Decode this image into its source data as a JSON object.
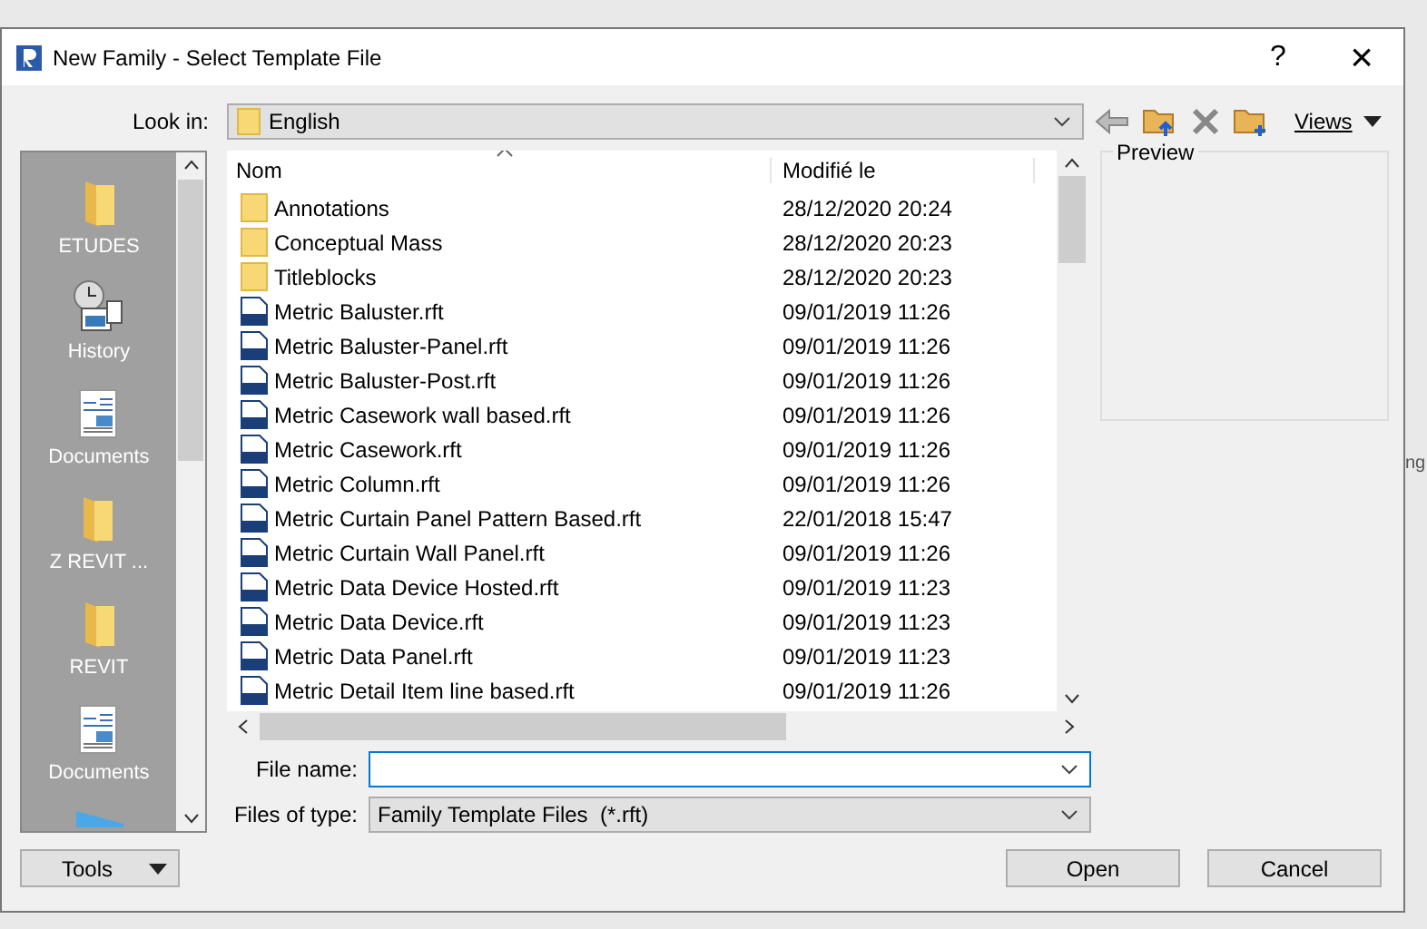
{
  "window": {
    "title": "New Family - Select Template File",
    "buttons": [
      "?",
      "×"
    ]
  },
  "look_in": {
    "label": "Look in:",
    "value": "English"
  },
  "toolbar": {
    "views_label": "Views"
  },
  "places": [
    {
      "kind": "folder",
      "label": "ETUDES"
    },
    {
      "kind": "history",
      "label": "History"
    },
    {
      "kind": "documents",
      "label": "Documents"
    },
    {
      "kind": "folder",
      "label": "Z REVIT ..."
    },
    {
      "kind": "folder",
      "label": "REVIT"
    },
    {
      "kind": "documents",
      "label": "Documents"
    },
    {
      "kind": "desktop"
    }
  ],
  "file_list": {
    "columns": [
      "Nom",
      "Modifié le"
    ],
    "rows": [
      {
        "kind": "folder",
        "name": "Annotations",
        "modified": "28/12/2020 20:24"
      },
      {
        "kind": "folder",
        "name": "Conceptual Mass",
        "modified": "28/12/2020 20:23"
      },
      {
        "kind": "folder",
        "name": "Titleblocks",
        "modified": "28/12/2020 20:23"
      },
      {
        "kind": "rft",
        "name": "Metric Baluster.rft",
        "modified": "09/01/2019 11:26"
      },
      {
        "kind": "rft",
        "name": "Metric Baluster-Panel.rft",
        "modified": "09/01/2019 11:26"
      },
      {
        "kind": "rft",
        "name": "Metric Baluster-Post.rft",
        "modified": "09/01/2019 11:26"
      },
      {
        "kind": "rft",
        "name": "Metric Casework wall based.rft",
        "modified": "09/01/2019 11:26"
      },
      {
        "kind": "rft",
        "name": "Metric Casework.rft",
        "modified": "09/01/2019 11:26"
      },
      {
        "kind": "rft",
        "name": "Metric Column.rft",
        "modified": "09/01/2019 11:26"
      },
      {
        "kind": "rft",
        "name": "Metric Curtain Panel Pattern Based.rft",
        "modified": "22/01/2018 15:47"
      },
      {
        "kind": "rft",
        "name": "Metric Curtain Wall Panel.rft",
        "modified": "09/01/2019 11:26"
      },
      {
        "kind": "rft",
        "name": "Metric Data Device Hosted.rft",
        "modified": "09/01/2019 11:23"
      },
      {
        "kind": "rft",
        "name": "Metric Data Device.rft",
        "modified": "09/01/2019 11:23"
      },
      {
        "kind": "rft",
        "name": "Metric Data Panel.rft",
        "modified": "09/01/2019 11:23"
      },
      {
        "kind": "rft",
        "name": "Metric Detail Item line based.rft",
        "modified": "09/01/2019 11:26"
      }
    ]
  },
  "preview": {
    "label": "Preview"
  },
  "file_name": {
    "label": "File name:"
  },
  "file_type": {
    "label": "Files of type:",
    "value": "Family Template Files  (*.rft)"
  },
  "buttons": {
    "tools": "Tools",
    "open": "Open",
    "cancel": "Cancel"
  },
  "background_text": "ng"
}
